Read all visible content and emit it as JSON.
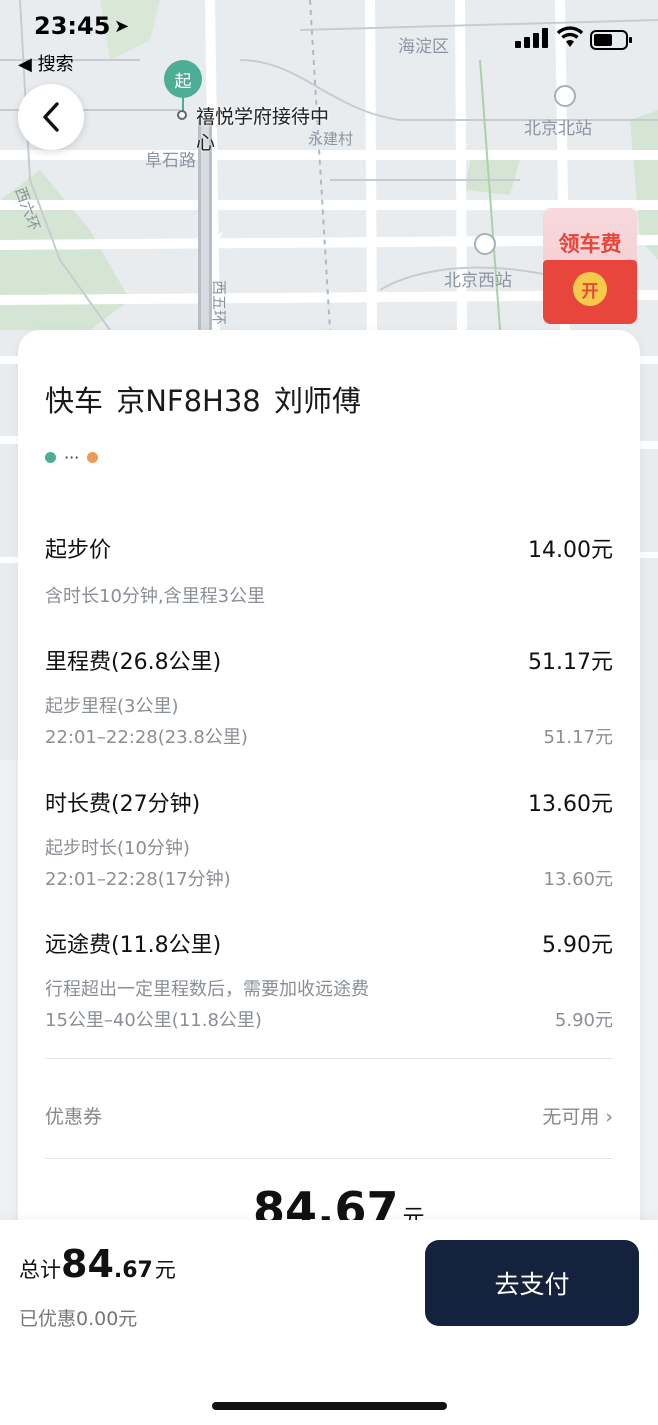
{
  "status_bar": {
    "time": "23:45",
    "back_app": "◀ 搜索"
  },
  "map": {
    "start_pin": "起",
    "start_label_line1": "禧悦学府接待中",
    "start_label_line2": "心",
    "labels": {
      "haidian": "海淀区",
      "beijing_north": "北京北站",
      "yongjiancun": "永建村",
      "fushilu": "阜石路",
      "west_sixth_ring": "西六环",
      "west_fifth_ring": "西五环",
      "beijing_west": "北京西站"
    }
  },
  "promo": {
    "text": "领车费",
    "coin": "开"
  },
  "trip": {
    "title": "快车  京NF8H38  刘师傅"
  },
  "fees": {
    "base": {
      "label": "起步价",
      "value": "14.00元",
      "note": "含时长10分钟,含里程3公里"
    },
    "mileage": {
      "label": "里程费(26.8公里)",
      "value": "51.17元",
      "sub1": "起步里程(3公里)",
      "sub2": "22:01–22:28(23.8公里)",
      "sub2_value": "51.17元"
    },
    "duration": {
      "label": "时长费(27分钟)",
      "value": "13.60元",
      "sub1": "起步时长(10分钟)",
      "sub2": "22:01–22:28(17分钟)",
      "sub2_value": "13.60元"
    },
    "long_distance": {
      "label": "远途费(11.8公里)",
      "value": "5.90元",
      "sub1": "行程超出一定里程数后，需要加收远途费",
      "sub2": "15公里–40公里(11.8公里)",
      "sub2_value": "5.90元"
    }
  },
  "coupon": {
    "label": "优惠券",
    "value": "无可用 ›"
  },
  "total_preview": {
    "amount": "84.67",
    "unit": "元"
  },
  "summary": {
    "label": "总计",
    "amount_int": "84",
    "amount_dec": ".67",
    "unit": "元",
    "discount": "已优惠0.00元",
    "pay_button": "去支付"
  }
}
